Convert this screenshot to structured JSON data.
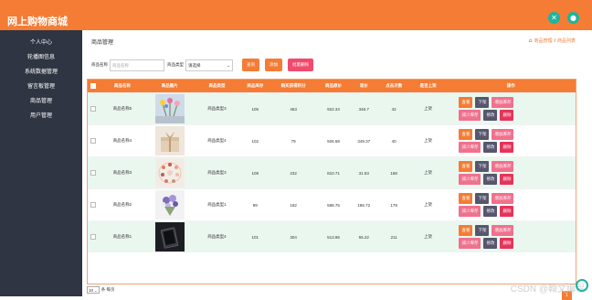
{
  "app": {
    "title": "网上购物商城"
  },
  "topbar": {
    "icons": [
      "close-icon",
      "user-icon"
    ],
    "accent": "#f47c35"
  },
  "sidebar": {
    "items": [
      {
        "label": "个人中心"
      },
      {
        "label": "轮播图信息"
      },
      {
        "label": "系统数据管理"
      },
      {
        "label": "留言板管理"
      },
      {
        "label": "商品管理"
      },
      {
        "label": "用户管理"
      }
    ]
  },
  "main": {
    "title": "商品管理",
    "breadcrumb": {
      "home_icon": "home-icon",
      "items": [
        "商品管理",
        "商品列表"
      ]
    },
    "search": {
      "name_label": "商品名称",
      "name_placeholder": "商品名称",
      "type_label": "商品类型",
      "type_value": "请选择",
      "buttons": {
        "search": "查询",
        "add": "添加",
        "batch_delete": "批量删除"
      }
    },
    "table": {
      "headers": [
        "商品名称",
        "商品图片",
        "商品类型",
        "商品库存",
        "购买获得积分",
        "商品原价",
        "现价",
        "点击次数",
        "是否上架",
        "操作"
      ],
      "rows": [
        {
          "name": "商品名称5",
          "image": "flowers",
          "type": "商品类型3",
          "stock": "105",
          "points": "463",
          "price": "922.34",
          "current": "346.7",
          "clicks": "42",
          "status": "上架"
        },
        {
          "name": "商品名称4",
          "image": "gift-box",
          "type": "商品类型4",
          "stock": "102",
          "points": "79",
          "price": "926.58",
          "current": "349.37",
          "clicks": "40",
          "status": "上架"
        },
        {
          "name": "商品名称3",
          "image": "cosmetics",
          "type": "商品类型3",
          "stock": "109",
          "points": "232",
          "price": "810.71",
          "current": "31.53",
          "clicks": "168",
          "status": "上架"
        },
        {
          "name": "商品名称2",
          "image": "bouquet",
          "type": "商品类型1",
          "stock": "99",
          "points": "182",
          "price": "588.75",
          "current": "186.72",
          "clicks": "179",
          "status": "上架"
        },
        {
          "name": "商品名称1",
          "image": "tablet",
          "type": "商品类型4",
          "stock": "101",
          "points": "304",
          "price": "513.86",
          "current": "55.22",
          "clicks": "211",
          "status": "上架"
        }
      ],
      "row_actions": [
        "查看",
        "下架",
        "增加库存",
        "减少库存",
        "修改",
        "删除"
      ]
    },
    "pager": {
      "page_size": "10",
      "suffix": "条 每页",
      "button": "1"
    }
  },
  "watermark": "CSDN @翰文编程"
}
